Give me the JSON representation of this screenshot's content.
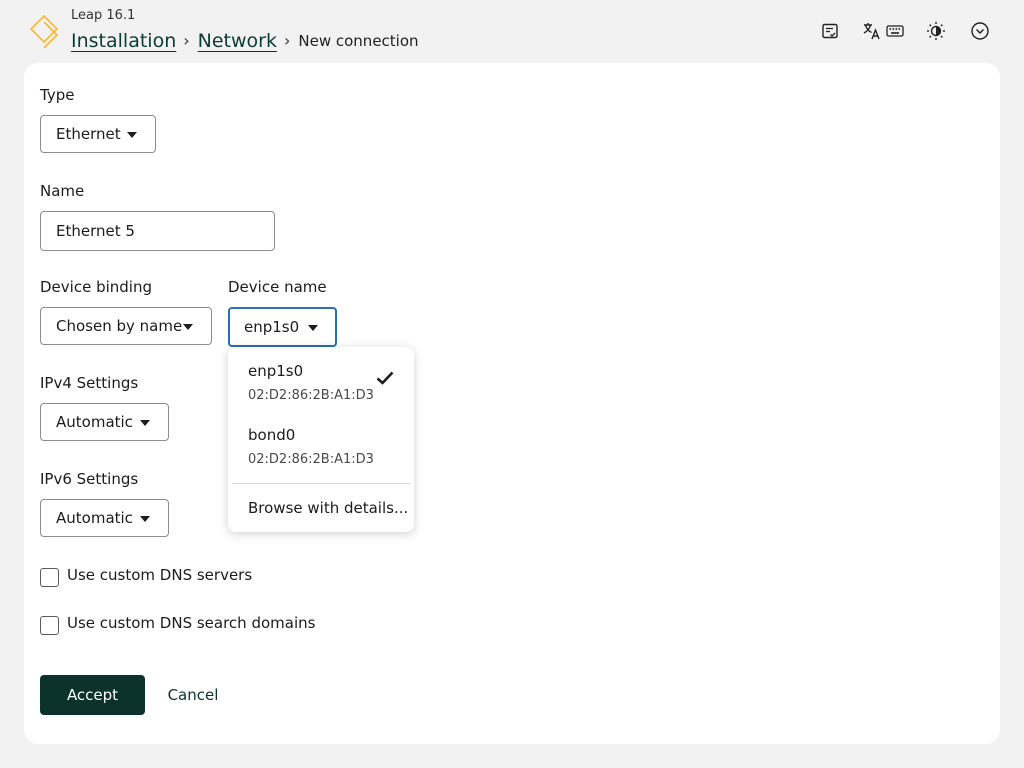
{
  "header": {
    "product": "Leap 16.1",
    "breadcrumbs": [
      "Installation",
      "Network"
    ],
    "current": "New connection",
    "icons": [
      "installer-options-icon",
      "language-icon",
      "keyboard-icon",
      "theme-icon",
      "more-options-icon"
    ]
  },
  "form": {
    "type": {
      "label": "Type",
      "value": "Ethernet"
    },
    "name": {
      "label": "Name",
      "value": "Ethernet 5"
    },
    "device_binding": {
      "label": "Device binding",
      "value": "Chosen by name"
    },
    "device_name": {
      "label": "Device name",
      "value": "enp1s0"
    },
    "ipv4": {
      "label": "IPv4 Settings",
      "value": "Automatic"
    },
    "ipv6": {
      "label": "IPv6 Settings",
      "value": "Automatic"
    },
    "dns_servers": {
      "label": "Use custom DNS servers",
      "checked": false
    },
    "dns_search": {
      "label": "Use custom DNS search domains",
      "checked": false
    }
  },
  "dropdown": {
    "options": [
      {
        "name": "enp1s0",
        "mac": "02:D2:86:2B:A1:D3",
        "selected": true
      },
      {
        "name": "bond0",
        "mac": "02:D2:86:2B:A1:D3",
        "selected": false
      }
    ],
    "browse": "Browse with details..."
  },
  "actions": {
    "accept": "Accept",
    "cancel": "Cancel"
  },
  "colors": {
    "accent": "#0c322c",
    "focus": "#2a6fb4",
    "logo": "#f7b731"
  }
}
